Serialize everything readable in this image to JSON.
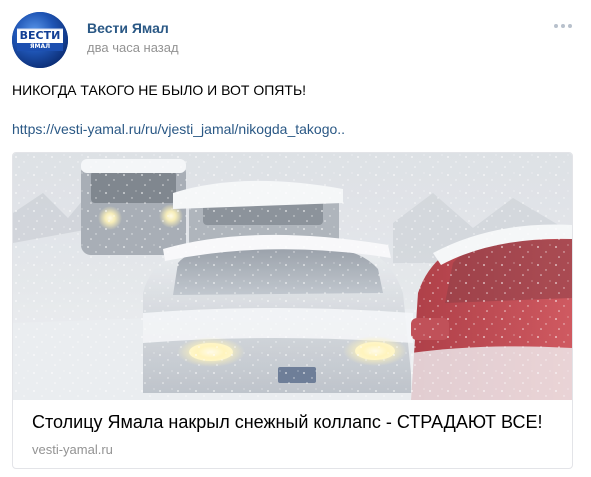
{
  "post": {
    "author": "Вести Ямал",
    "time": "два часа назад",
    "text": "НИКОГДА ТАКОГО НЕ БЫЛО И ВОТ ОПЯТЬ!",
    "link": "https://vesti-yamal.ru/ru/vjesti_jamal/nikogda_takogo.."
  },
  "avatar": {
    "logo_text": "ВЕСТИ",
    "logo_subtext": "ЯМАЛ"
  },
  "card": {
    "title": "Столицу Ямала накрыл снежный коллапс - СТРАДАЮТ ВСЕ!",
    "domain": "vesti-yamal.ru",
    "image_icon": "snowy-road-cars-photo"
  },
  "colors": {
    "link": "#2a5885",
    "muted": "#939393",
    "border": "#e3e4e8"
  }
}
